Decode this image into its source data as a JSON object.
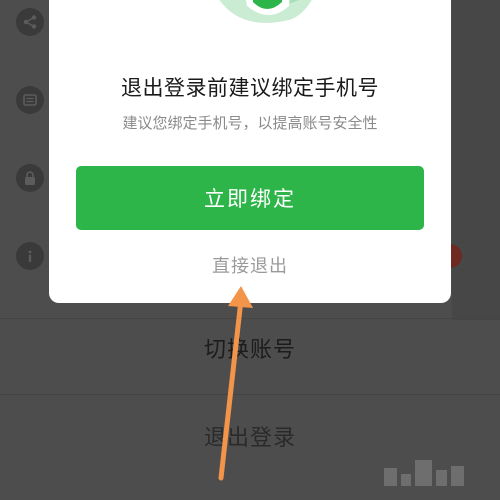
{
  "dialog": {
    "title": "退出登录前建议绑定手机号",
    "subtitle": "建议您绑定手机号，以提高账号安全性",
    "bind_button_label": "立即绑定",
    "exit_link_label": "直接退出"
  },
  "background_menu": {
    "switch_account_label": "切换账号",
    "logout_label": "退出登录"
  },
  "colors": {
    "accent_green": "#2db54a",
    "annotation_arrow": "#f2954a"
  },
  "icons": [
    "share-icon",
    "list-icon",
    "lock-icon",
    "info-icon",
    "shield-icon"
  ]
}
